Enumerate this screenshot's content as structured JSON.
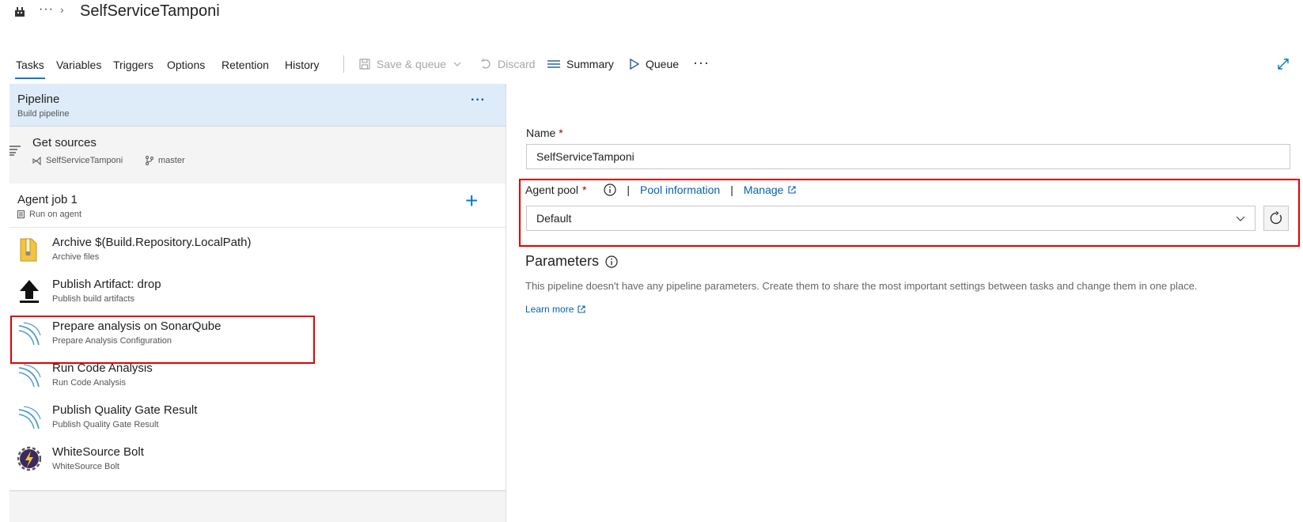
{
  "header": {
    "more": "···",
    "chevron": "›",
    "title": "SelfServiceTamponi"
  },
  "toolbar": {
    "tabs": [
      "Tasks",
      "Variables",
      "Triggers",
      "Options",
      "Retention",
      "History"
    ],
    "active_tab": "Tasks",
    "save_queue_label": "Save & queue",
    "discard_label": "Discard",
    "summary_label": "Summary",
    "queue_label": "Queue",
    "more": "···"
  },
  "pipeline": {
    "title": "Pipeline",
    "subtitle": "Build pipeline",
    "more": "···"
  },
  "get_sources": {
    "title": "Get sources",
    "repo": "SelfServiceTamponi",
    "branch": "master"
  },
  "agent_job": {
    "title": "Agent job 1",
    "subtitle": "Run on agent",
    "add": "+"
  },
  "tasks": [
    {
      "title": "Archive $(Build.Repository.LocalPath)",
      "subtitle": "Archive files",
      "icon": "zip-archive-icon"
    },
    {
      "title": "Publish Artifact: drop",
      "subtitle": "Publish build artifacts",
      "icon": "upload-arrow-icon"
    },
    {
      "title": "Prepare analysis on SonarQube",
      "subtitle": "Prepare Analysis Configuration",
      "icon": "sonarqube-icon"
    },
    {
      "title": "Run Code Analysis",
      "subtitle": "Run Code Analysis",
      "icon": "sonarqube-icon"
    },
    {
      "title": "Publish Quality Gate Result",
      "subtitle": "Publish Quality Gate Result",
      "icon": "sonarqube-icon"
    },
    {
      "title": "WhiteSource Bolt",
      "subtitle": "WhiteSource Bolt",
      "icon": "whitesource-bolt-icon"
    }
  ],
  "form": {
    "name_label": "Name",
    "required_mark": "*",
    "name_value": "SelfServiceTamponi",
    "agent_pool_label": "Agent pool",
    "pool_info_link": "Pool information",
    "manage_link": "Manage",
    "pipe_sep": "|",
    "agent_pool_value": "Default",
    "parameters_title": "Parameters",
    "parameters_desc": "This pipeline doesn't have any pipeline parameters. Create them to share the most important settings between tasks and change them in one place.",
    "learn_more": "Learn more"
  },
  "colors": {
    "accent": "#0078d4",
    "highlight_box": "#e00000",
    "pipeline_header_bg": "#deecf9"
  }
}
